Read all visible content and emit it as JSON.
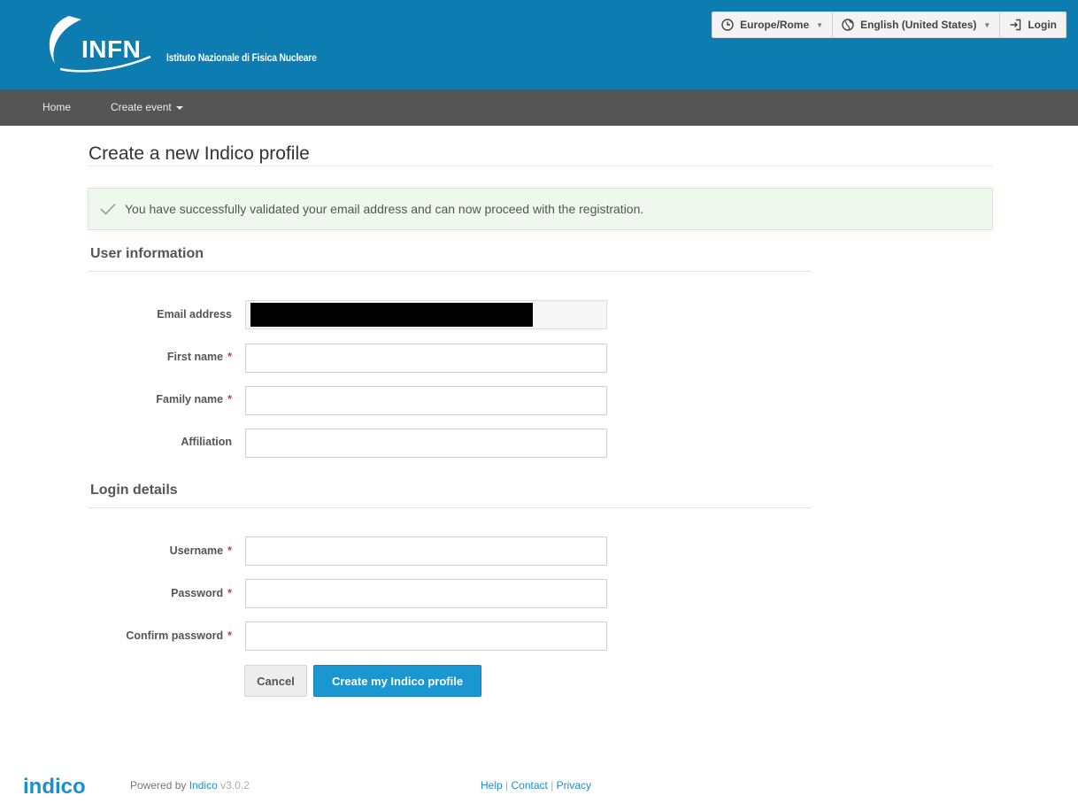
{
  "header": {
    "logo_text": "INFN",
    "tagline": "Istituto Nazionale di Fisica Nucleare",
    "timezone": "Europe/Rome",
    "language": "English (United States)",
    "login_label": "Login",
    "bg_color": "#0d7cb0"
  },
  "nav": {
    "home": "Home",
    "create_event": "Create event"
  },
  "page": {
    "title": "Create a new Indico profile",
    "alert": "You have successfully validated your email address and can now proceed with the registration."
  },
  "user_info": {
    "heading": "User information",
    "email_label": "Email address",
    "first_name_label": "First name",
    "family_name_label": "Family name",
    "affiliation_label": "Affiliation"
  },
  "login_details": {
    "heading": "Login details",
    "username_label": "Username",
    "password_label": "Password",
    "confirm_label": "Confirm password"
  },
  "required_mark": "*",
  "buttons": {
    "cancel": "Cancel",
    "submit": "Create my Indico profile"
  },
  "footer": {
    "logo_text": "indico",
    "powered_by": "Powered by",
    "indico_link": "Indico",
    "version": "v3.0.2",
    "help": "Help",
    "contact": "Contact",
    "privacy": "Privacy",
    "separator": "|"
  },
  "colors": {
    "accent": "#1a96d1",
    "nav_bg": "#555555",
    "success_bg": "#eef8ed",
    "required": "#c2433c"
  }
}
